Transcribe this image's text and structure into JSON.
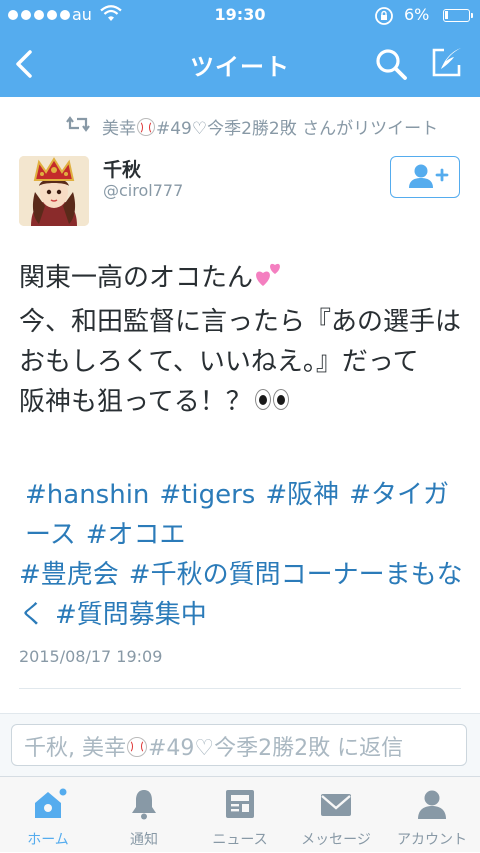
{
  "status_bar": {
    "carrier": "au",
    "time": "19:30",
    "battery": "6%"
  },
  "nav": {
    "title": "ツイート"
  },
  "retweet": {
    "prefix": "美幸",
    "suffix": "#49♡今季2勝2敗 さんがリツイート"
  },
  "author": {
    "name": "千秋",
    "handle": "@cirol777"
  },
  "tweet": {
    "line1": "関東一高のオコたん",
    "line2": "今、和田監督に言ったら『あの選手はおもしろくて、いいねえ。』だって",
    "line3": "阪神も狙ってる！？",
    "hashtags": [
      "#hanshin",
      "#tigers",
      "#阪神",
      "#タイガース",
      "#オコエ",
      "#豊虎会",
      "#千秋の質問コーナーまもなく",
      "#質問募集中"
    ],
    "timestamp": "2015/08/17 19:09"
  },
  "reply": {
    "prefix": "千秋, 美幸",
    "suffix": "#49♡今季2勝2敗 に返信"
  },
  "tabs": [
    {
      "label": "ホーム",
      "icon": "home-icon",
      "active": true
    },
    {
      "label": "通知",
      "icon": "bell-icon",
      "active": false
    },
    {
      "label": "ニュース",
      "icon": "news-icon",
      "active": false
    },
    {
      "label": "メッセージ",
      "icon": "envelope-icon",
      "active": false
    },
    {
      "label": "アカウント",
      "icon": "person-icon",
      "active": false
    }
  ],
  "colors": {
    "brand": "#55acee",
    "hashtag": "#2b7bb9",
    "muted": "#8899a6"
  }
}
